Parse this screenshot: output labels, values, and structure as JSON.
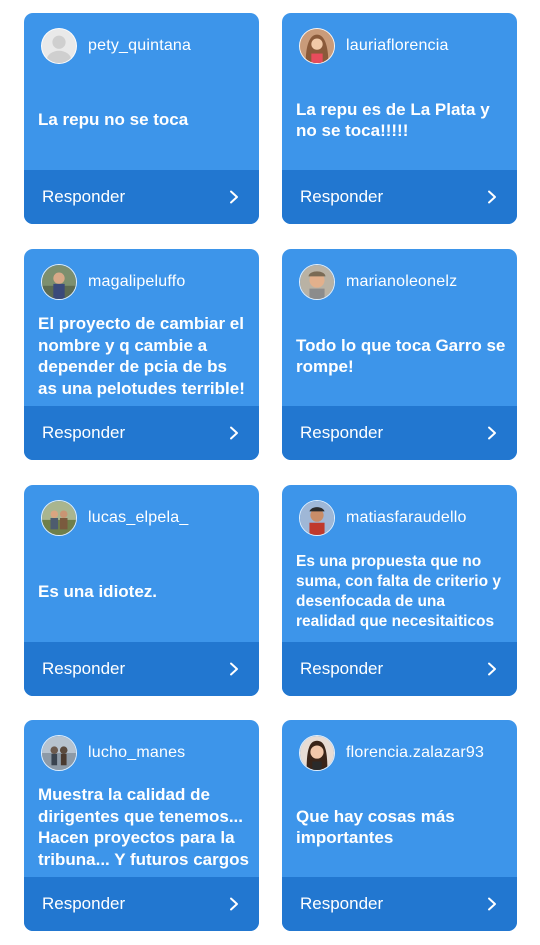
{
  "reply_label": "Responder",
  "colors": {
    "card_background": "#3d95ea",
    "reply_bar_background": "#2277d0",
    "text": "#ffffff"
  },
  "cards": [
    {
      "username": "pety_quintana",
      "question": "La repu no se toca",
      "avatar_icon": "default-avatar-icon"
    },
    {
      "username": "lauriaflorencia",
      "question": "La repu es de La Plata y no se toca!!!!!",
      "avatar_icon": "user-photo-avatar"
    },
    {
      "username": "magalipeluffo",
      "question": "El proyecto de cambiar el nombre y q cambie a depender de pcia de bs as una pelotudes terrible!",
      "avatar_icon": "user-photo-avatar"
    },
    {
      "username": "marianoleonelz",
      "question": "Todo lo que toca Garro se rompe!",
      "avatar_icon": "user-photo-avatar"
    },
    {
      "username": "lucas_elpela_",
      "question": "Es una idiotez.",
      "avatar_icon": "user-photo-avatar"
    },
    {
      "username": "matiasfaraudello",
      "question": "Es una propuesta que no suma, con falta de criterio y desenfocada de una realidad que necesitaiticos",
      "avatar_icon": "user-photo-avatar"
    },
    {
      "username": "lucho_manes",
      "question": "Muestra la calidad de dirigentes que tenemos... Hacen proyectos para la tribuna... Y futuros cargos",
      "avatar_icon": "user-photo-avatar"
    },
    {
      "username": "florencia.zalazar93",
      "question": "Que hay cosas más importantes",
      "avatar_icon": "user-photo-avatar"
    }
  ]
}
